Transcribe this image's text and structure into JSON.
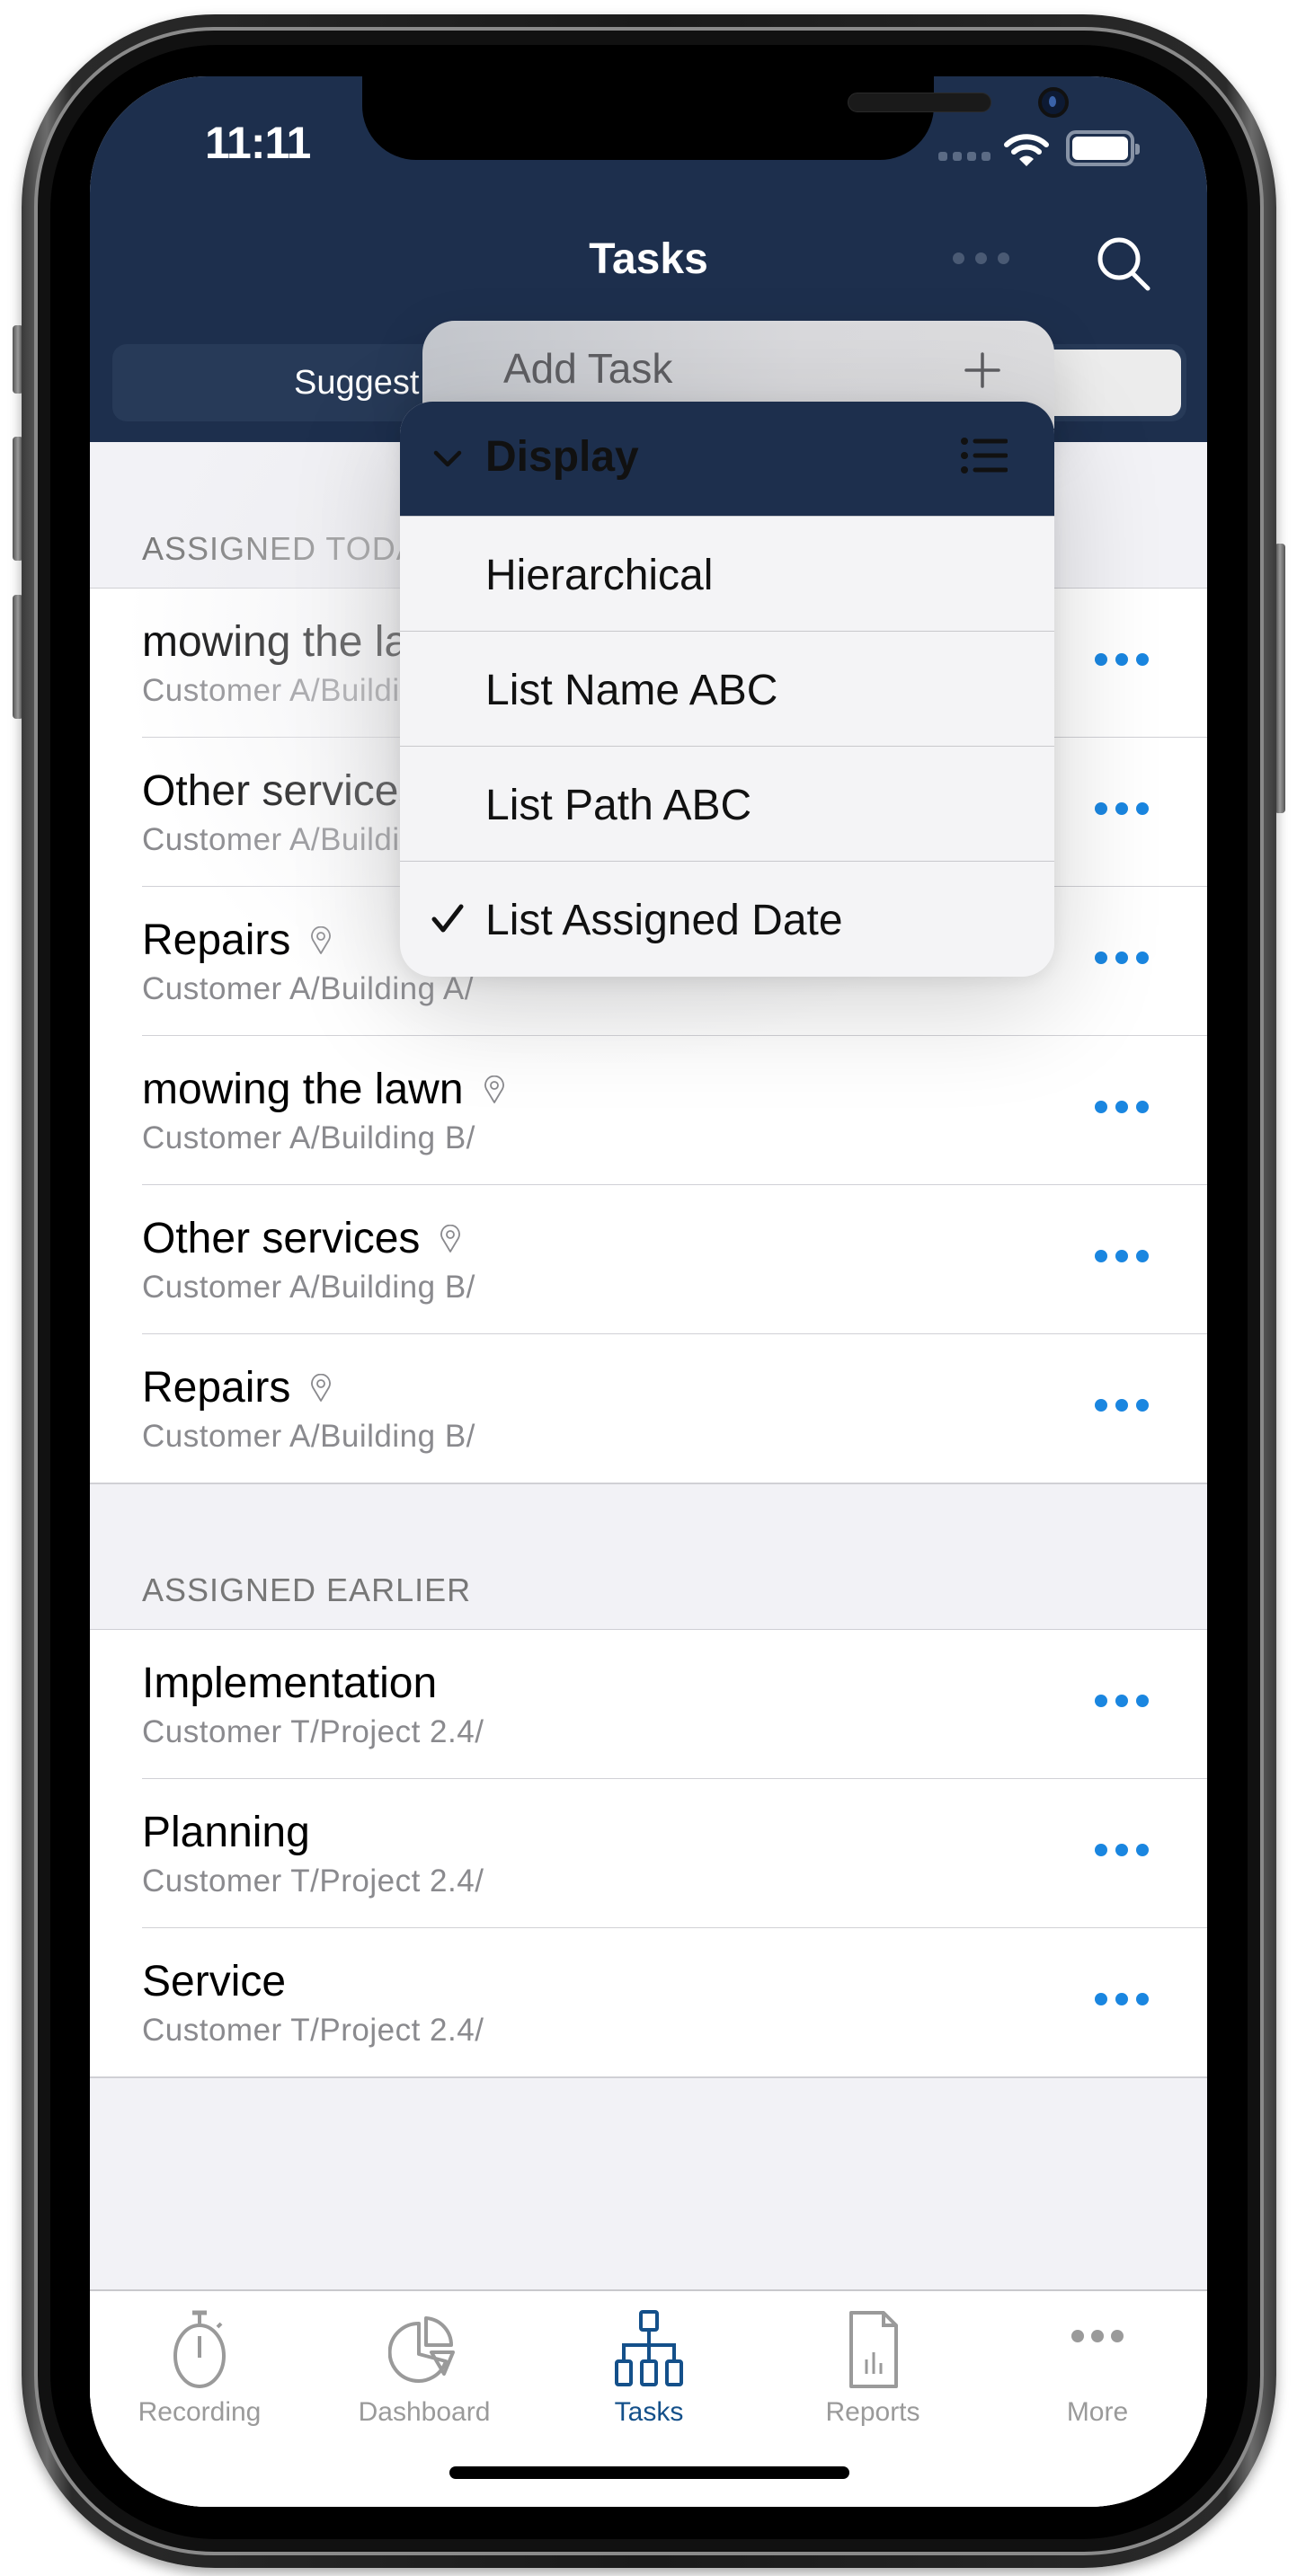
{
  "status_bar": {
    "time": "11:11"
  },
  "nav": {
    "title": "Tasks",
    "more_icon": "ellipsis-icon",
    "search_icon": "search-icon"
  },
  "segmented": {
    "left_label_visible": "Suggest"
  },
  "menu": {
    "add_task_label": "Add Task",
    "add_task_icon": "plus-icon",
    "display": {
      "label": "Display",
      "icon": "list-bullet-icon",
      "expanded": true
    },
    "options": [
      {
        "label": "Hierarchical",
        "checked": false
      },
      {
        "label": "List Name ABC",
        "checked": false
      },
      {
        "label": "List Path ABC",
        "checked": false
      },
      {
        "label": "List Assigned Date",
        "checked": true
      }
    ]
  },
  "sections": [
    {
      "header": "ASSIGNED TODAY",
      "rows": [
        {
          "title": "mowing the lawn",
          "subtitle": "Customer A/Building A/",
          "has_location": true
        },
        {
          "title": "Other services",
          "subtitle": "Customer A/Building A/",
          "has_location": true
        },
        {
          "title": "Repairs",
          "subtitle": "Customer A/Building A/",
          "has_location": true
        },
        {
          "title": "mowing the lawn",
          "subtitle": "Customer A/Building B/",
          "has_location": true
        },
        {
          "title": "Other services",
          "subtitle": "Customer A/Building B/",
          "has_location": true
        },
        {
          "title": "Repairs",
          "subtitle": "Customer A/Building B/",
          "has_location": true
        }
      ]
    },
    {
      "header": "ASSIGNED EARLIER",
      "rows": [
        {
          "title": "Implementation",
          "subtitle": "Customer T/Project 2.4/",
          "has_location": false
        },
        {
          "title": "Planning",
          "subtitle": "Customer T/Project 2.4/",
          "has_location": false
        },
        {
          "title": "Service",
          "subtitle": "Customer T/Project 2.4/",
          "has_location": false
        }
      ]
    }
  ],
  "tabbar": {
    "active": "Tasks",
    "tabs": [
      {
        "label": "Recording",
        "icon": "stopwatch-icon"
      },
      {
        "label": "Dashboard",
        "icon": "pie-chart-icon"
      },
      {
        "label": "Tasks",
        "icon": "hierarchy-icon"
      },
      {
        "label": "Reports",
        "icon": "report-document-icon"
      },
      {
        "label": "More",
        "icon": "ellipsis-icon"
      }
    ]
  },
  "colors": {
    "header_bg": "#1d2f4d",
    "accent_blue": "#1a86e0",
    "tab_active": "#14508a",
    "tab_inactive": "#9a9a9a"
  }
}
